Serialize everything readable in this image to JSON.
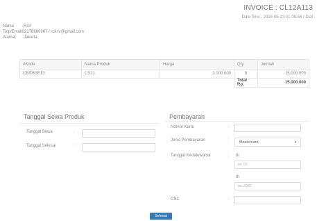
{
  "invoice": {
    "title": "INVOICE : CL12A113",
    "datetime": "DateTime : 2016-05-23 01:09:56 / Diaf"
  },
  "customer": {
    "name_label": "Nama",
    "name_value": "Rcli",
    "contact_label": "Telp/Email",
    "contact_value": "02178600967 / rcli.tv@gmail.com",
    "address_label": "Alamat",
    "address_value": "Jakarta"
  },
  "table": {
    "headers": [
      "#Kode",
      "Nama Produk",
      "Harga",
      "Qty",
      "Jumlah"
    ],
    "rows": [
      {
        "kode": "CBID63E13",
        "produk": "CS21",
        "harga": "3.000.000",
        "qty": "5",
        "jumlah": "15.000.000"
      }
    ],
    "total_label": "Total Rp.",
    "total_value": "15.000.000"
  },
  "rental": {
    "title": "Tanggal Sewa Produk",
    "start_label": "Tanggal Sewa",
    "end_label": "Tanggal Selesai",
    "colon": ":"
  },
  "payment": {
    "title": "Pembayaran",
    "card_label": "Nomor Kartu",
    "type_label": "Jenis Pembayaran",
    "type_value": "Mastercard",
    "expiry_label": "Tanggal Kedaluwarsa",
    "month_label": "bl",
    "month_placeholder": "ex: 02",
    "year_label": "th",
    "year_placeholder": "ex: 2020",
    "csc_label": "CSC",
    "colon": ":"
  },
  "submit": {
    "label": "Selesai"
  },
  "colors": {
    "accent": "#337ab7"
  }
}
